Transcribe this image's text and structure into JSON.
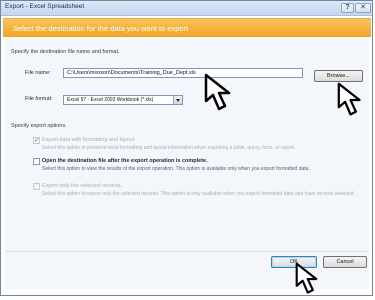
{
  "window": {
    "title": "Export - Excel Spreadsheet",
    "help_label": "?",
    "close_label": "✕"
  },
  "banner": {
    "heading": "Select the destination for the data you want to export"
  },
  "destination": {
    "section_label": "Specify the destination file name and format.",
    "file_name_label": "File name:",
    "file_name_value": "C:\\Users\\mxoxon\\Documents\\Training_Due_Dept.xls",
    "browse_label": "Browse...",
    "file_format_label": "File format:",
    "file_format_value": "Excel 97 - Excel 2003 Workbook (*.xls)"
  },
  "export_options": {
    "section_label": "Specify export options.",
    "options": [
      {
        "title": "Export data with formatting and layout.",
        "description": "Select this option to preserve most formatting and layout information when exporting a table, query, form, or report.",
        "checked": true,
        "enabled": false
      },
      {
        "title": "Open the destination file after the export operation is complete.",
        "description": "Select this option to view the results of the export operation. This option is available only when you export formatted data.",
        "checked": false,
        "enabled": true
      },
      {
        "title": "Export only the selected records.",
        "description": "Select this option to export only the selected records. This option is only available when you export formatted data and have records selected.",
        "checked": false,
        "enabled": false
      }
    ]
  },
  "footer": {
    "ok_label": "OK",
    "cancel_label": "Cancel"
  },
  "colors": {
    "banner": "#f0a626",
    "accent_border": "#3c7fb1",
    "panel_background": "#f3f6fb"
  },
  "icons": [
    "pointer-cursor-icon",
    "checkmark-icon",
    "chevron-down-icon",
    "close-icon",
    "help-icon"
  ]
}
